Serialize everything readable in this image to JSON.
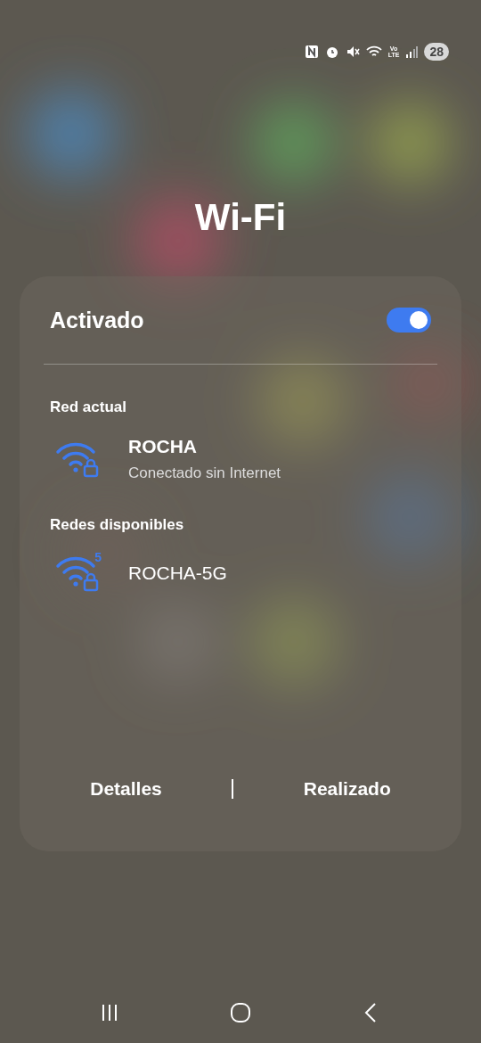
{
  "status_bar": {
    "volte": "Vo\nLTE",
    "battery": "28"
  },
  "title": "Wi-Fi",
  "toggle": {
    "label": "Activado",
    "on": true
  },
  "current": {
    "header": "Red actual",
    "network": {
      "name": "ROCHA",
      "status": "Conectado sin Internet",
      "locked": true
    }
  },
  "available": {
    "header": "Redes disponibles",
    "networks": [
      {
        "name": "ROCHA-5G",
        "band": "5",
        "locked": true
      }
    ]
  },
  "buttons": [
    "Detalles",
    "Realizado"
  ]
}
